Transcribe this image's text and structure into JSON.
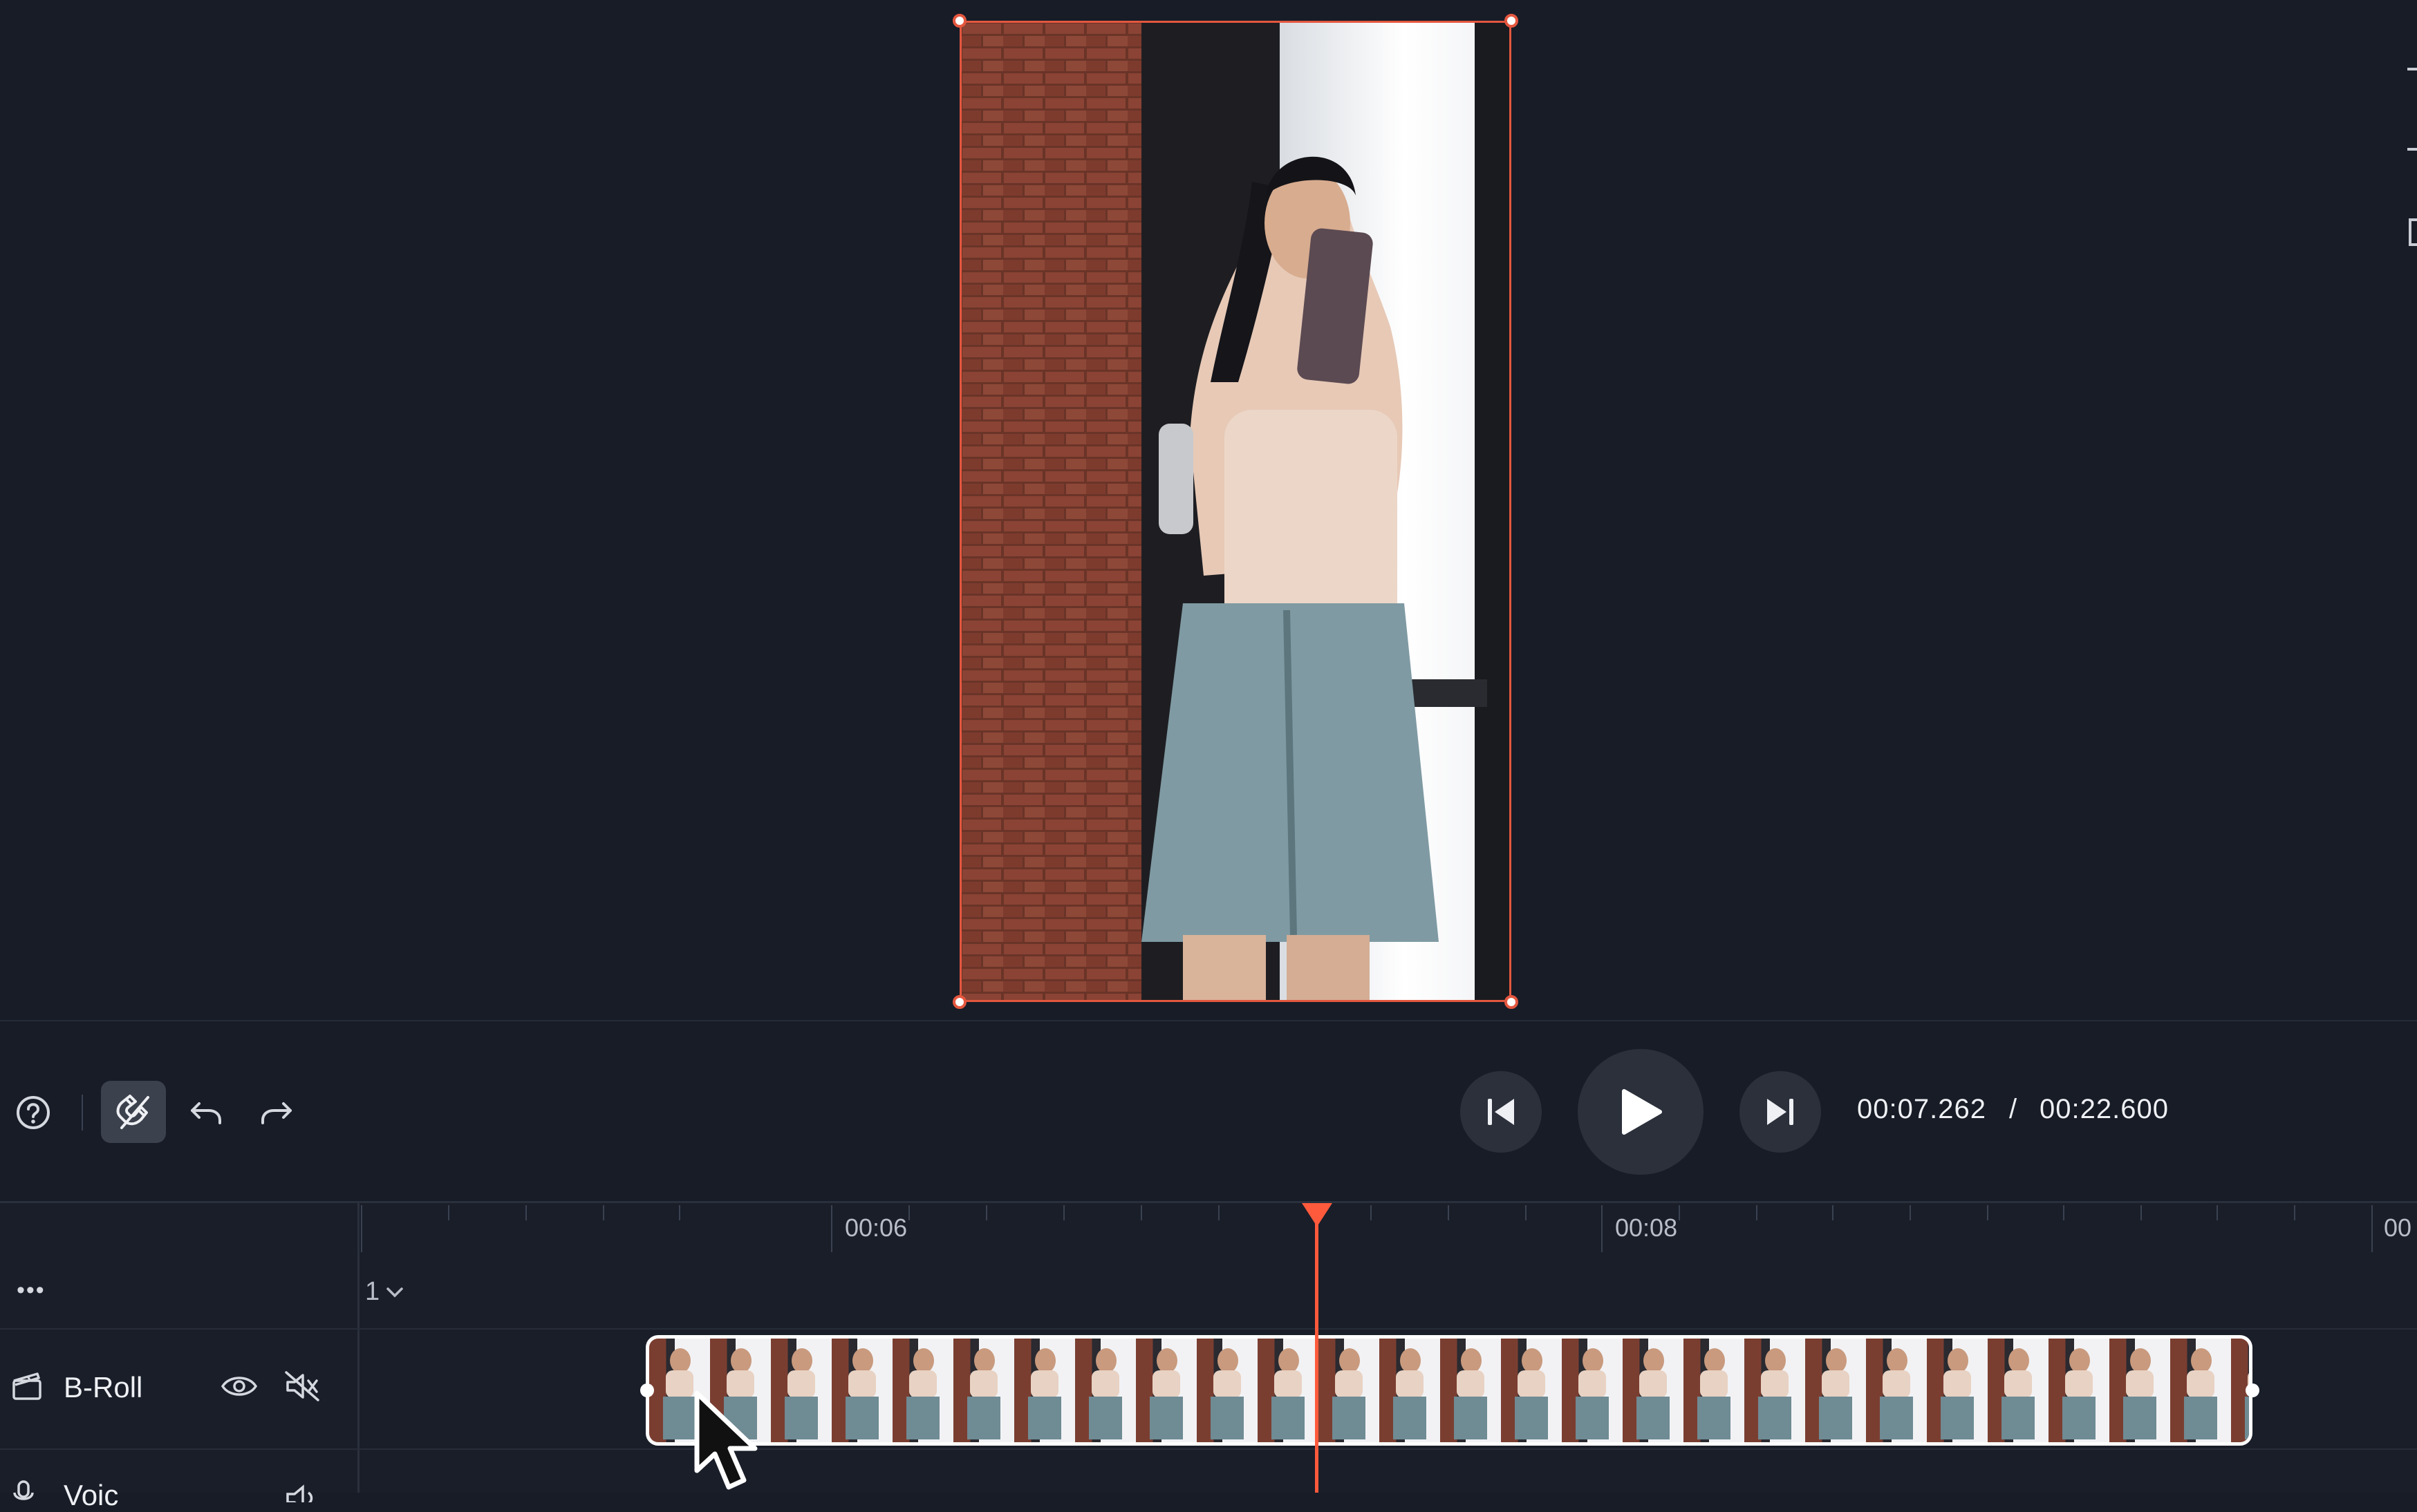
{
  "player": {
    "current_time": "00:07.262",
    "separator": "/",
    "total_time": "00:22.600"
  },
  "toolbar": {
    "help_icon": "help-circle-icon",
    "magnet_icon": "magnet-snap-icon",
    "undo_icon": "undo-icon",
    "redo_icon": "redo-icon",
    "skip_back_icon": "skip-back-icon",
    "play_icon": "play-icon",
    "skip_forward_icon": "skip-forward-icon"
  },
  "timeline": {
    "ruler_labels": [
      "00:06",
      "00:08",
      "00"
    ],
    "more_label": "•••",
    "zoom_value": "1",
    "tracks": [
      {
        "name": "B-Roll",
        "icon": "clapperboard-icon"
      },
      {
        "name": "Voic",
        "icon": "microphone-icon"
      }
    ]
  },
  "colors": {
    "accent": "#ff5a3c",
    "background": "#171c27",
    "selection": "#e4573f"
  }
}
